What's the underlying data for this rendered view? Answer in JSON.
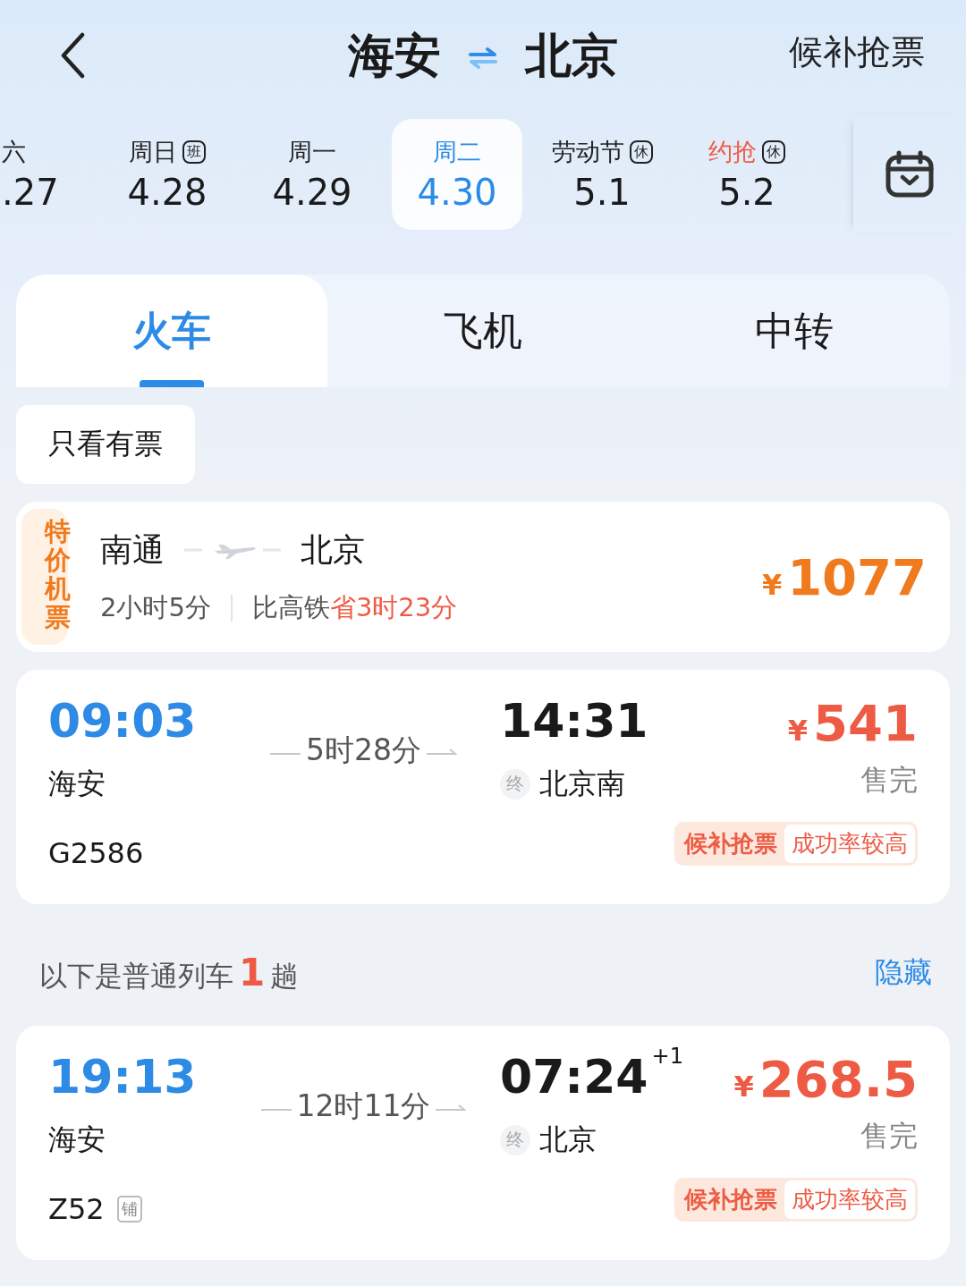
{
  "header": {
    "origin": "海安",
    "destination": "北京",
    "action": "候补抢票"
  },
  "dates": [
    {
      "weekday": "六",
      "date": ".27",
      "selected": false,
      "highlight": false
    },
    {
      "weekday": "周日",
      "badge": "班",
      "date": "4.28",
      "selected": false,
      "highlight": false
    },
    {
      "weekday": "周一",
      "date": "4.29",
      "selected": false,
      "highlight": false
    },
    {
      "weekday": "周二",
      "date": "4.30",
      "selected": true,
      "highlight": false
    },
    {
      "weekday": "劳动节",
      "badge": "休",
      "date": "5.1",
      "selected": false,
      "highlight": false
    },
    {
      "weekday": "约抢",
      "badge": "休",
      "date": "5.2",
      "selected": false,
      "highlight": true
    }
  ],
  "transport_tabs": [
    {
      "label": "火车",
      "selected": true
    },
    {
      "label": "飞机",
      "selected": false
    },
    {
      "label": "中转",
      "selected": false
    }
  ],
  "filters": [
    {
      "label": "只看有票",
      "selected": false
    }
  ],
  "flight_deal": {
    "badge": "特价机票",
    "from": "南通",
    "to": "北京",
    "duration": "2小时5分",
    "compare": "比高铁",
    "saving": "省3时23分",
    "currency": "¥",
    "price": "1077"
  },
  "trains": [
    {
      "depart_time": "09:03",
      "depart_station": "海安",
      "train_no": "G2586",
      "duration": "5时28分",
      "arrive_time": "14:31",
      "terminal_mark": "终",
      "arrive_station": "北京南",
      "currency": "¥",
      "price": "541",
      "availability": "售完",
      "waitlist": {
        "label": "候补抢票",
        "rate": "成功率较高"
      }
    }
  ],
  "regular_section": {
    "prefix": "以下是普通列车",
    "count": "1",
    "suffix": "趟",
    "hide_link": "隐藏",
    "trains": [
      {
        "depart_time": "19:13",
        "depart_station": "海安",
        "train_no": "Z52",
        "berth_tag": "铺",
        "duration": "12时11分",
        "arrive_time": "07:24",
        "day_offset": "+1",
        "terminal_mark": "终",
        "arrive_station": "北京",
        "currency": "¥",
        "price": "268.5",
        "availability": "售完",
        "waitlist": {
          "label": "候补抢票",
          "rate": "成功率较高"
        }
      }
    ]
  }
}
